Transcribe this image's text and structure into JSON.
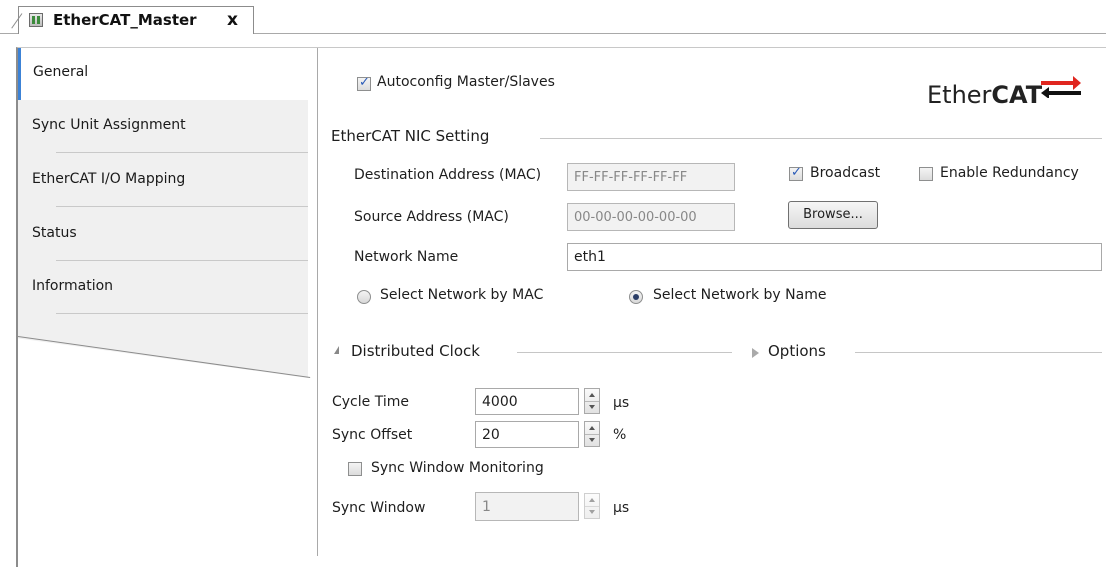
{
  "tab": {
    "title": "EtherCAT_Master",
    "close": "x"
  },
  "sidebar": {
    "items": [
      {
        "label": "General"
      },
      {
        "label": "Sync Unit Assignment"
      },
      {
        "label": "EtherCAT I/O Mapping"
      },
      {
        "label": "Status"
      },
      {
        "label": "Information"
      }
    ]
  },
  "general": {
    "autoconfig_label": "Autoconfig Master/Slaves",
    "autoconfig_checked": true,
    "logo_text_regular": "Ether",
    "logo_text_bold": "CAT"
  },
  "nic": {
    "title": "EtherCAT NIC Setting",
    "dest_label": "Destination Address (MAC)",
    "dest_value": "FF-FF-FF-FF-FF-FF",
    "broadcast_label": "Broadcast",
    "broadcast_checked": true,
    "redundancy_label": "Enable Redundancy",
    "redundancy_checked": false,
    "src_label": "Source Address (MAC)",
    "src_value": "00-00-00-00-00-00",
    "browse_label": "Browse...",
    "network_name_label": "Network Name",
    "network_name_value": "eth1",
    "radio_mac_label": "Select Network by MAC",
    "radio_name_label": "Select Network by Name",
    "selected_radio": "name"
  },
  "dc": {
    "title": "Distributed Clock",
    "options_label": "Options",
    "cycle_time_label": "Cycle Time",
    "cycle_time_value": "4000",
    "cycle_time_unit": "µs",
    "sync_offset_label": "Sync Offset",
    "sync_offset_value": "20",
    "sync_offset_unit": "%",
    "sync_window_monitoring_label": "Sync Window Monitoring",
    "sync_window_monitoring_checked": false,
    "sync_window_label": "Sync Window",
    "sync_window_value": "1",
    "sync_window_unit": "µs"
  },
  "colors": {
    "accent": "#3c82d6",
    "border": "#a9a9a9",
    "panel": "#f0f0f0"
  }
}
